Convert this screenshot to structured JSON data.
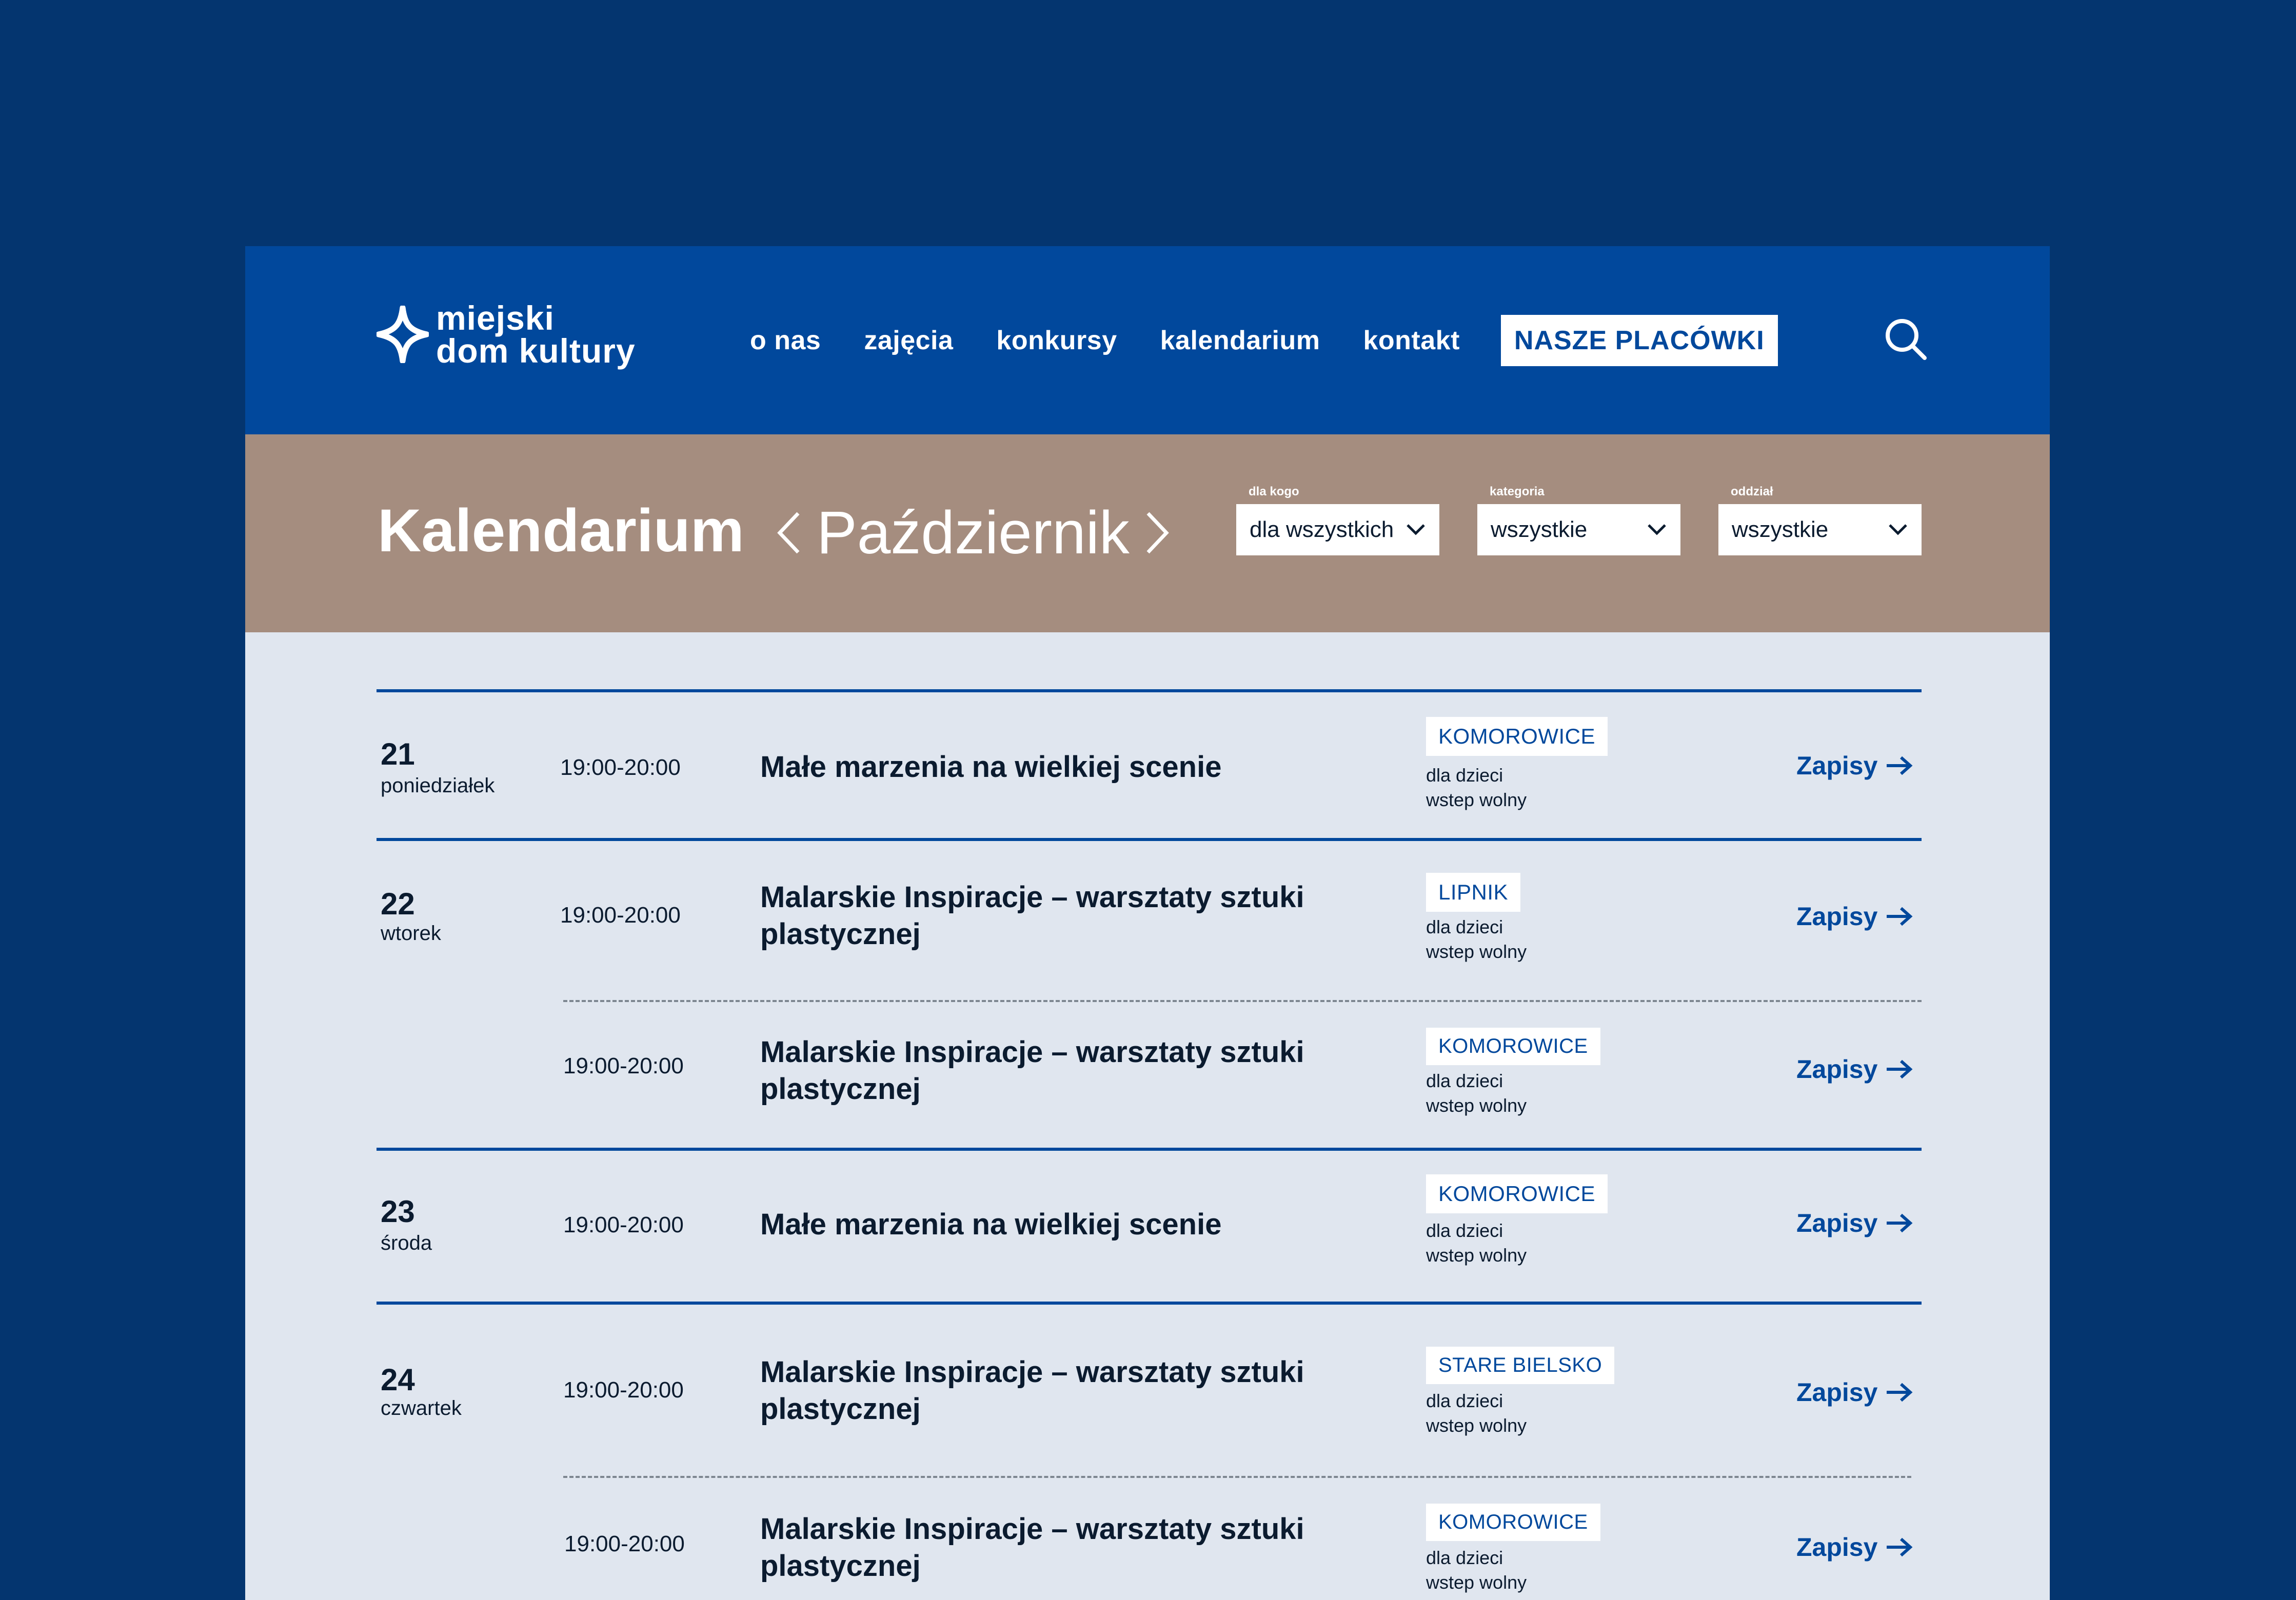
{
  "header": {
    "logo_line1": "miejski",
    "logo_line2": "dom kultury",
    "nav": [
      "o nas",
      "zajęcia",
      "konkursy",
      "kalendarium",
      "kontakt"
    ],
    "cta": "NASZE PLACÓWKI",
    "logo_icon": "star-diamond-icon",
    "search_icon": "search-icon"
  },
  "band": {
    "title": "Kalendarium",
    "month": "Październik",
    "filters": [
      {
        "label": "dla kogo",
        "value": "dla wszystkich"
      },
      {
        "label": "kategoria",
        "value": "wszystkie"
      },
      {
        "label": "oddział",
        "value": "wszystkie"
      }
    ]
  },
  "events": [
    {
      "day": "21",
      "dow": "poniedziałek",
      "time": "19:00-20:00",
      "title": "Małe marzenia na wielkiej scenie",
      "place": "KOMOROWICE",
      "audience": "dla dzieci",
      "entry": "wstep wolny",
      "action": "Zapisy"
    },
    {
      "day": "22",
      "dow": "wtorek",
      "time": "19:00-20:00",
      "title": "Malarskie Inspiracje – warsztaty sztuki plastycznej",
      "place": "LIPNIK",
      "audience": "dla dzieci",
      "entry": "wstep wolny",
      "action": "Zapisy"
    },
    {
      "day": "",
      "dow": "",
      "time": "19:00-20:00",
      "title": "Malarskie Inspiracje – warsztaty sztuki plastycznej",
      "place": "KOMOROWICE",
      "audience": "dla dzieci",
      "entry": "wstep wolny",
      "action": "Zapisy"
    },
    {
      "day": "23",
      "dow": "środa",
      "time": "19:00-20:00",
      "title": "Małe marzenia na wielkiej scenie",
      "place": "KOMOROWICE",
      "audience": "dla dzieci",
      "entry": "wstep wolny",
      "action": "Zapisy"
    },
    {
      "day": "24",
      "dow": "czwartek",
      "time": "19:00-20:00",
      "title": "Malarskie Inspiracje – warsztaty sztuki plastycznej",
      "place": "STARE BIELSKO",
      "audience": "dla dzieci",
      "entry": "wstep wolny",
      "action": "Zapisy"
    },
    {
      "day": "",
      "dow": "",
      "time": "19:00-20:00",
      "title": "Malarskie Inspiracje – warsztaty sztuki plastycznej",
      "place": "KOMOROWICE",
      "audience": "dla dzieci",
      "entry": "wstep wolny",
      "action": "Zapisy"
    }
  ],
  "colors": {
    "page_bg": "#04356f",
    "header_bg": "#01489c",
    "band_bg": "#a58d7f",
    "content_bg": "#e0e6ef",
    "accent": "#01489c"
  }
}
